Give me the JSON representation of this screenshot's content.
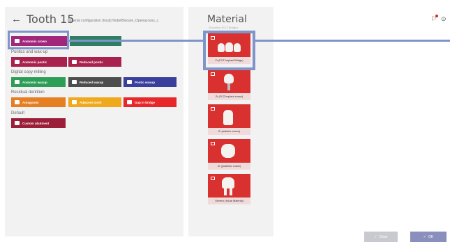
{
  "header": {
    "back": "←",
    "title": "Tooth 15",
    "subtitle": "Material configuration (local)  NobelBiocare_Openaccess_c"
  },
  "groups": [
    {
      "label": "",
      "buttons": [
        {
          "label": "Anatomic crown",
          "color": "#a2267a",
          "icon": "tooth-icon",
          "selected": true
        },
        {
          "label": "",
          "color": "#2f7f63",
          "icon": "none",
          "selected": false
        }
      ]
    },
    {
      "label": "Pontics and wax-up",
      "buttons": [
        {
          "label": "Anatomic pontic",
          "color": "#a8224d",
          "icon": "pontic-icon"
        },
        {
          "label": "Reduced pontic",
          "color": "#a8224d",
          "icon": "pontic-icon"
        }
      ]
    },
    {
      "label": "Digital copy milling",
      "buttons": [
        {
          "label": "Anatomic waxup",
          "color": "#2e9e57",
          "icon": "waxup-icon"
        },
        {
          "label": "Reduced waxup",
          "color": "#4d4d4d",
          "icon": "waxup-icon"
        },
        {
          "label": "Pontic waxup",
          "color": "#3b3f9c",
          "icon": "waxup-icon"
        }
      ]
    },
    {
      "label": "Residual dentition",
      "buttons": [
        {
          "label": "Antagonist",
          "color": "#e67e22",
          "icon": "antagonist-icon"
        },
        {
          "label": "Adjacent tooth",
          "color": "#f0a81c",
          "icon": "adjacent-icon"
        },
        {
          "label": "Gap in bridge",
          "color": "#e8272b",
          "icon": "gap-icon"
        }
      ]
    },
    {
      "label": "Default",
      "buttons": [
        {
          "label": "Custom abutment",
          "color": "#9c1f3a",
          "icon": "abutment-icon"
        }
      ]
    }
  ],
  "material": {
    "title": "Material",
    "subtitle": "Zirconium (FCZ Bridge)",
    "cards": [
      {
        "label": "Zr (FCZ Implant Bridge)",
        "selected": true
      },
      {
        "label": "Zr (FCZ Implant crown)",
        "selected": false
      },
      {
        "label": "Zr (anterior crown)",
        "selected": false
      },
      {
        "label": "Zr (posterior crown)",
        "selected": false
      },
      {
        "label": "Generic (inLab Material)",
        "selected": false
      }
    ]
  },
  "toolbar": {
    "notifications_icon": "bell-icon",
    "help_icon": "help-icon"
  },
  "footer": {
    "clear_label": "Clear",
    "ok_label": "OK",
    "check": "✓"
  }
}
